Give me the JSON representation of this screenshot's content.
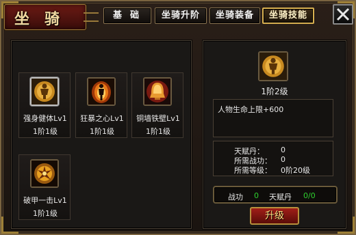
{
  "header": {
    "title": "坐骑"
  },
  "tabs": [
    {
      "label": "基础",
      "active": false
    },
    {
      "label": "坐骑升阶",
      "active": false
    },
    {
      "label": "坐骑装备",
      "active": false
    },
    {
      "label": "坐骑技能",
      "active": true
    }
  ],
  "skills": [
    {
      "name": "强身健体Lv1",
      "level": "1阶1级",
      "icon": "golden-warrior-icon",
      "selected": true
    },
    {
      "name": "狂暴之心Lv1",
      "level": "1阶1级",
      "icon": "flame-figure-icon",
      "selected": false
    },
    {
      "name": "铜墙铁壁Lv1",
      "level": "1阶1级",
      "icon": "bronze-bell-shield-icon",
      "selected": false
    },
    {
      "name": "破甲一击Lv1",
      "level": "1阶1级",
      "icon": "shattered-armor-icon",
      "selected": false
    }
  ],
  "detail": {
    "icon": "golden-warrior-icon",
    "level": "1阶2级",
    "description": "人物生命上限+600",
    "requirements": [
      {
        "label": "天赋丹：",
        "value": "0"
      },
      {
        "label": "所需战功：",
        "value": "0"
      },
      {
        "label": "所需等级：",
        "value": "0阶20级"
      }
    ],
    "resources": {
      "merit_label": "战功",
      "merit_value": "0",
      "pill_label": "天赋丹",
      "pill_value": "0/0"
    },
    "upgrade_label": "升级"
  },
  "colors": {
    "accent_gold": "#d8b050",
    "value_green": "#2ed12e",
    "button_red": "#a01e18"
  }
}
